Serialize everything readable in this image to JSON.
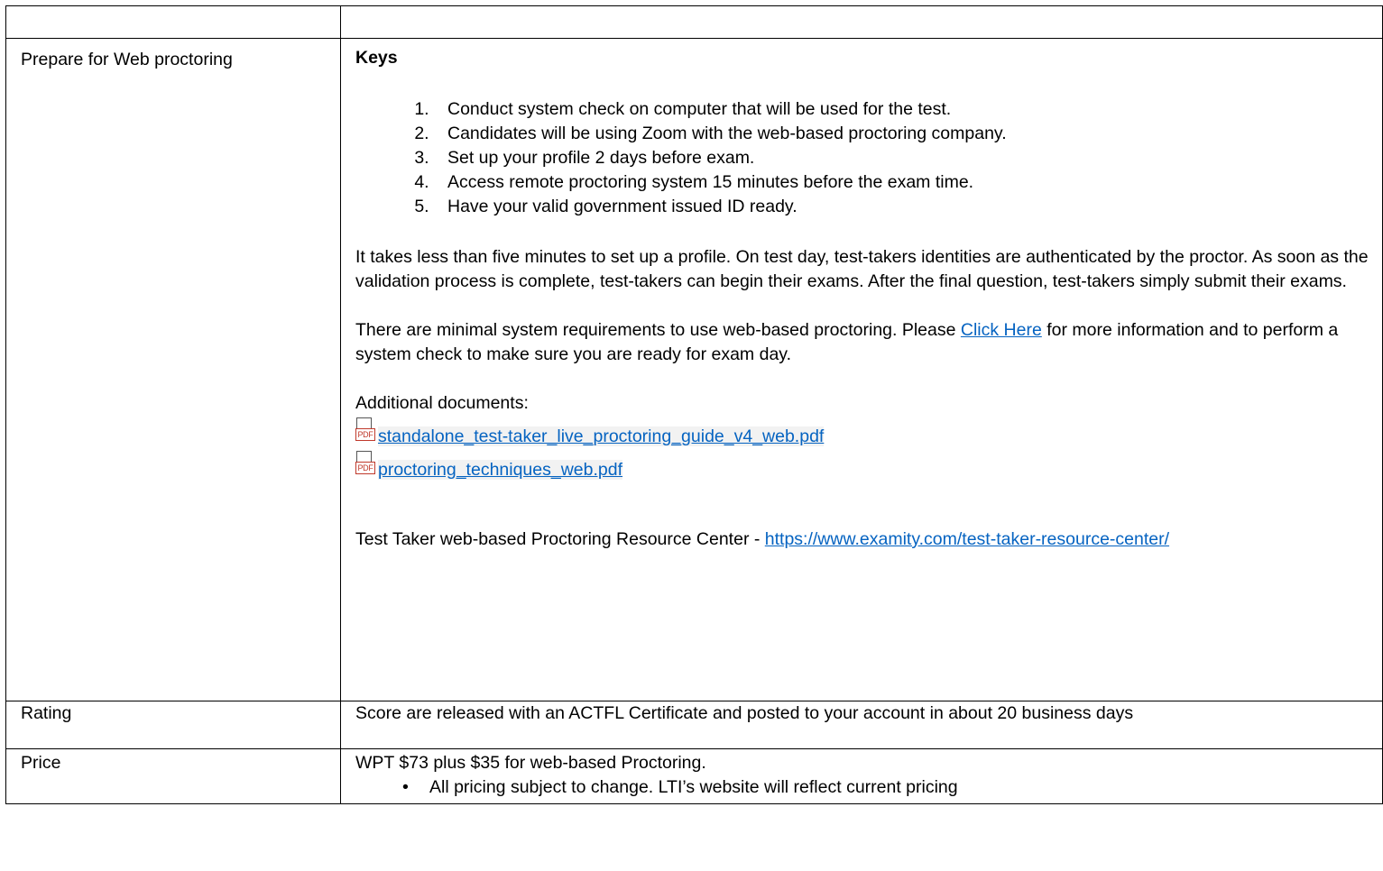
{
  "table": {
    "header_row": {
      "label": "",
      "content": ""
    },
    "proctoring": {
      "label": "Prepare for Web proctoring",
      "keys_heading": "Keys",
      "keys": [
        "Conduct system check on computer that will be used for the test.",
        "Candidates will be using Zoom with the web-based proctoring company.",
        "Set up your profile 2 days before exam.",
        "Access remote proctoring system 15 minutes before the exam time.",
        "Have your valid government issued ID ready."
      ],
      "paragraph_1": "It takes less than five minutes to set up a profile. On test day, test-takers identities are authenticated by the proctor. As soon as the validation process is complete, test-takers can begin their exams. After the final question, test-takers simply submit their exams.",
      "paragraph_2_before": "There are minimal system requirements to use web-based proctoring. Please ",
      "paragraph_2_link": "Click Here",
      "paragraph_2_after": " for more information and to perform a system check to make sure you are ready for exam day.",
      "additional_label": "Additional documents:",
      "documents": [
        {
          "icon": "pdf-file-icon",
          "badge": "PDF",
          "name": "standalone_test-taker_live_proctoring_guide_v4_web.pdf"
        },
        {
          "icon": "pdf-file-icon",
          "badge": "PDF",
          "name": "proctoring_techniques_web.pdf"
        }
      ],
      "resource_label": "Test Taker web-based Proctoring Resource Center - ",
      "resource_link": "https://www.examity.com/test-taker-resource-center/"
    },
    "rating": {
      "label": "Rating",
      "text": "Score are released with an ACTFL Certificate and posted to your account in about 20 business days"
    },
    "price": {
      "label": "Price",
      "text": "WPT $73 plus $35 for web-based Proctoring.",
      "notes": [
        "All pricing subject to change.  LTI’s website will reflect current pricing"
      ]
    }
  },
  "colors": {
    "link": "#0563c1",
    "border": "#000000",
    "pdf_badge": "#c0392b"
  }
}
